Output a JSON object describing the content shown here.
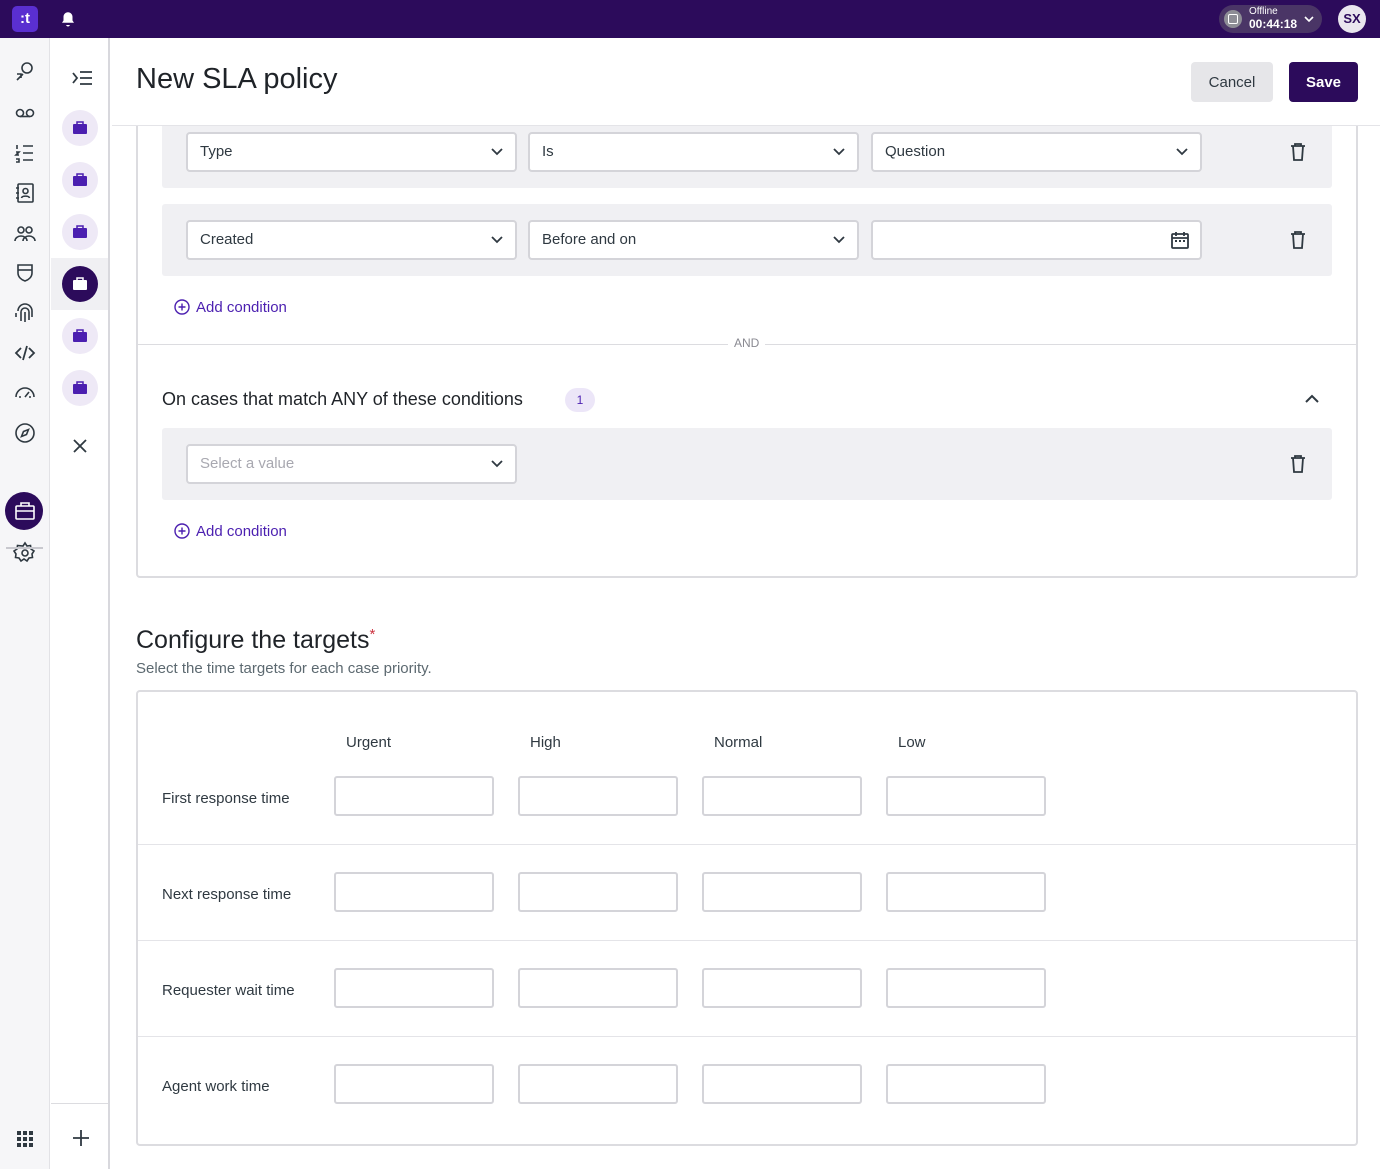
{
  "app": {
    "logo_text": ":t",
    "status": {
      "label": "Offline",
      "timer": "00:44:18"
    },
    "avatar_initials": "SX"
  },
  "rail": {
    "icons": [
      "routing-icon",
      "voicemail-icon",
      "queue-list-icon",
      "contacts-icon",
      "teams-icon",
      "shield-icon",
      "fingerprint-icon",
      "code-icon",
      "dashboard-gauge-icon",
      "compass-icon",
      "briefcase-icon",
      "settings-icon"
    ],
    "active": "briefcase-icon",
    "bottom": "apps-grid-icon"
  },
  "header": {
    "title": "New SLA policy",
    "cancel_label": "Cancel",
    "save_label": "Save"
  },
  "all_conditions": {
    "rows": [
      {
        "field": "Type",
        "operator": "Is",
        "value": "Question"
      },
      {
        "field": "Created",
        "operator": "Before and on",
        "value": ""
      }
    ],
    "add_label": "Add condition"
  },
  "separator": "AND",
  "any_conditions": {
    "title": "On cases that match ANY of these conditions",
    "count": "1",
    "rows": [
      {
        "field_placeholder": "Select a value"
      }
    ],
    "add_label": "Add condition"
  },
  "targets": {
    "title": "Configure the targets",
    "required_mark": "*",
    "subtitle": "Select the time targets for each case priority.",
    "priorities": [
      "Urgent",
      "High",
      "Normal",
      "Low"
    ],
    "rows": [
      "First response time",
      "Next response time",
      "Requester wait time",
      "Agent work time"
    ]
  },
  "colors": {
    "brand": "#2c0b5b",
    "accent": "#4b1fb0",
    "required": "#cc3340"
  }
}
